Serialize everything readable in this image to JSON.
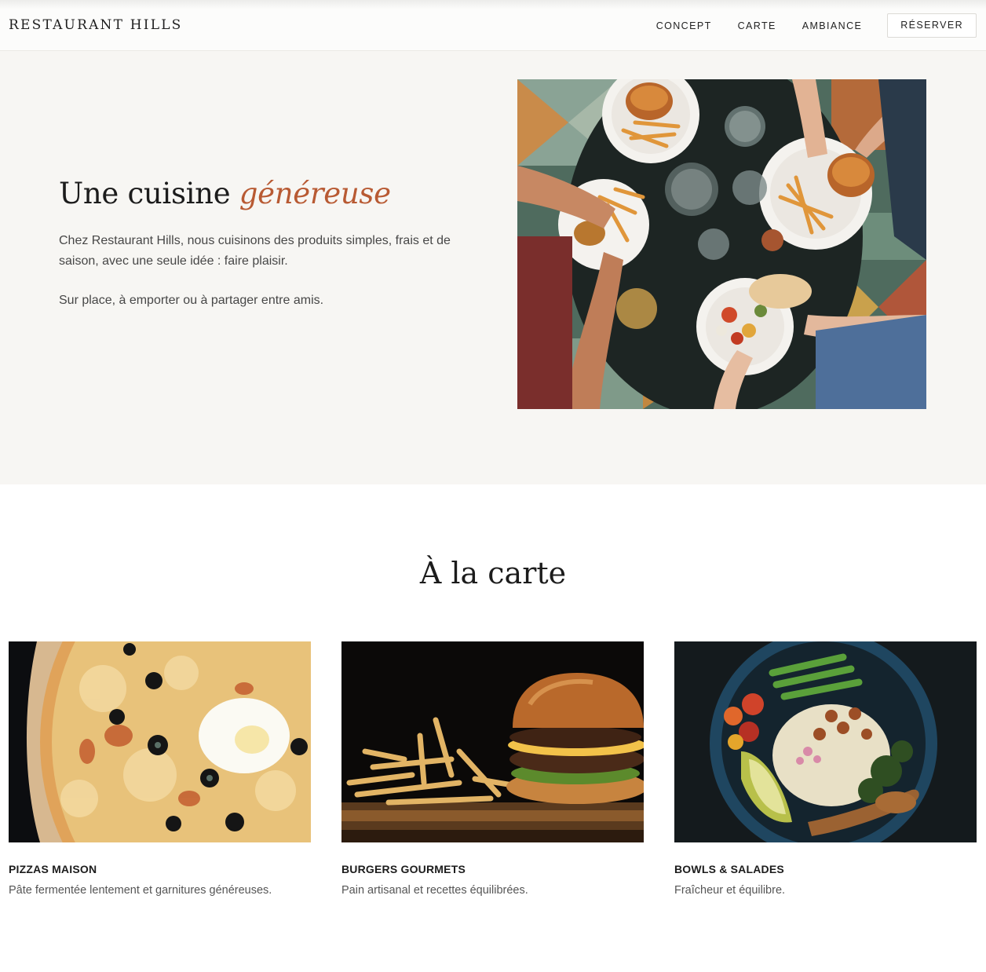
{
  "header": {
    "logo": "RESTAURANT HILLS",
    "nav": [
      "CONCEPT",
      "CARTE",
      "AMBIANCE"
    ],
    "reserve": "RÉSERVER"
  },
  "hero": {
    "title_plain": "Une cuisine ",
    "title_accent": "généreuse",
    "paragraph_1": "Chez Restaurant Hills, nous cuisinons des produits simples, frais et de saison, avec une seule idée : faire plaisir.",
    "paragraph_2": "Sur place, à emporter ou à partager entre amis.",
    "accent_color": "#b85a33"
  },
  "carte": {
    "title": "À la carte",
    "items": [
      {
        "name": "PIZZAS MAISON",
        "description": "Pâte fermentée lentement et garnitures généreuses."
      },
      {
        "name": "BURGERS GOURMETS",
        "description": "Pain artisanal et recettes équilibrées."
      },
      {
        "name": "BOWLS & SALADES",
        "description": "Fraîcheur et équilibre."
      }
    ]
  }
}
